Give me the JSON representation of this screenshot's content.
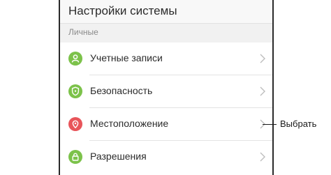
{
  "header": {
    "title": "Настройки системы"
  },
  "section": {
    "label": "Личные"
  },
  "items": [
    {
      "label": "Учетные записи",
      "icon": "account-icon",
      "color": "#7cc24a"
    },
    {
      "label": "Безопасность",
      "icon": "shield-icon",
      "color": "#7cc24a"
    },
    {
      "label": "Местоположение",
      "icon": "location-pin-icon",
      "color": "#e8555a"
    },
    {
      "label": "Разрешения",
      "icon": "lock-icon",
      "color": "#7cc24a"
    }
  ],
  "callout": {
    "text": "Выбрать"
  },
  "colors": {
    "accent_green": "#7cc24a",
    "accent_red": "#e8555a"
  }
}
